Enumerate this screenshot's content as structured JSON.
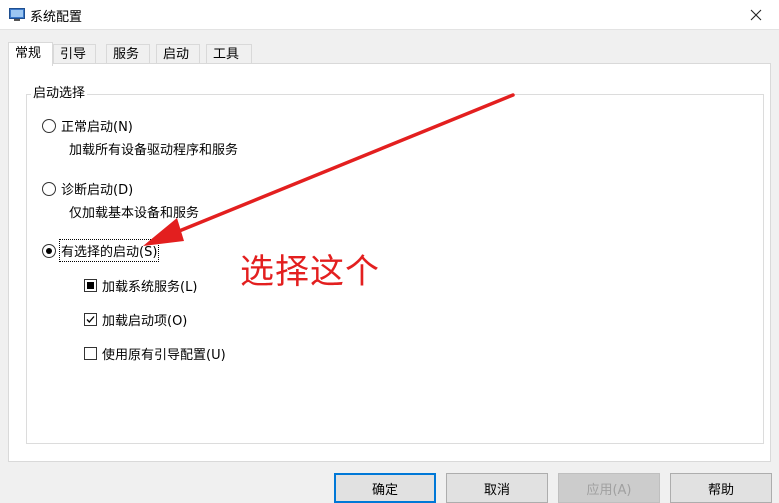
{
  "window": {
    "title": "系统配置"
  },
  "tabs": [
    {
      "label": "常规",
      "active": true
    },
    {
      "label": "引导"
    },
    {
      "label": "服务"
    },
    {
      "label": "启动"
    },
    {
      "label": "工具"
    }
  ],
  "startup": {
    "group_title": "启动选择",
    "options": [
      {
        "label": "正常启动(N)",
        "description": "加载所有设备驱动程序和服务",
        "selected": false
      },
      {
        "label": "诊断启动(D)",
        "description": "仅加载基本设备和服务",
        "selected": false
      },
      {
        "label": "有选择的启动(S)",
        "selected": true
      }
    ],
    "checkboxes": [
      {
        "label": "加载系统服务(L)",
        "state": "indeterminate"
      },
      {
        "label": "加载启动项(O)",
        "state": "checked"
      },
      {
        "label": "使用原有引导配置(U)",
        "state": "unchecked"
      }
    ]
  },
  "annotation": {
    "text": "选择这个",
    "color": "#e31f1f"
  },
  "buttons": {
    "ok": "确定",
    "cancel": "取消",
    "apply": "应用(A)",
    "help": "帮助"
  },
  "icons": {
    "app": "system-config-icon",
    "close": "close-icon"
  }
}
